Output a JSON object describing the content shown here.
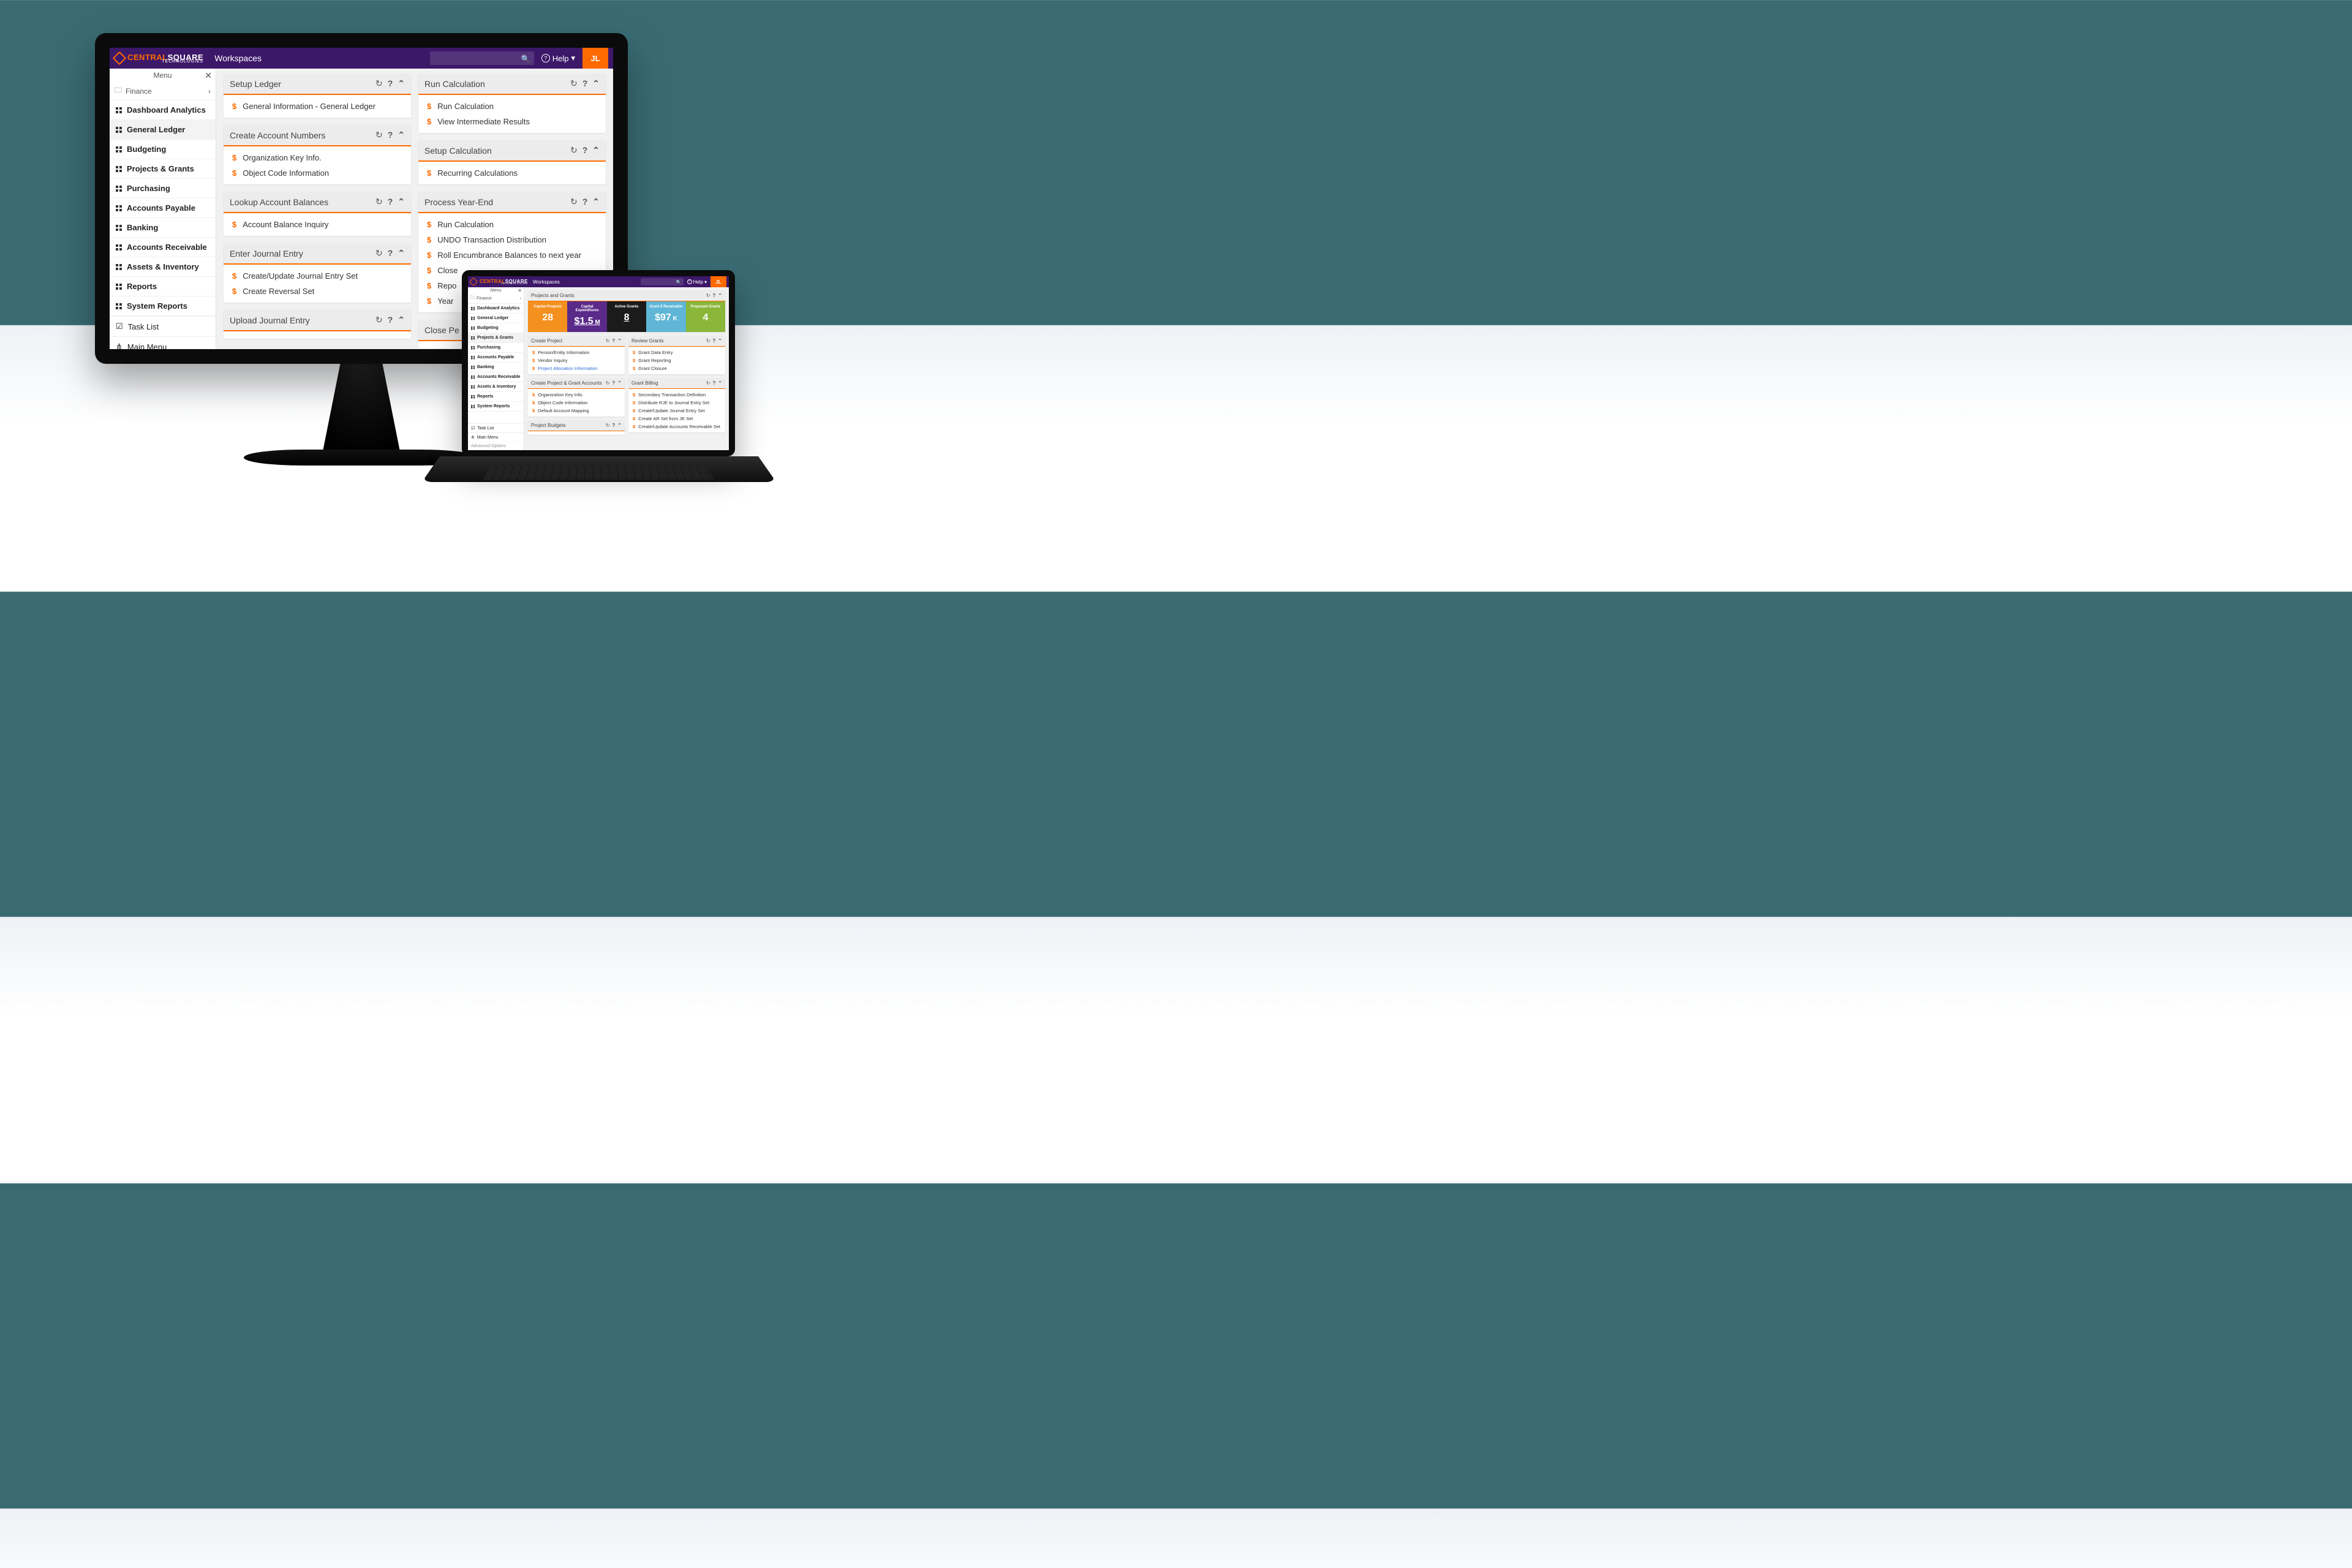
{
  "brand": {
    "name_html_prefix": "CENTRAL",
    "name_html_suffix": "SQUARE",
    "sub": "TECHNOLOGIES"
  },
  "header": {
    "title": "Workspaces",
    "help": "Help",
    "avatar": "JL",
    "menu_label": "Menu",
    "folder": "Finance"
  },
  "sidebar": {
    "items": [
      "Dashboard Analytics",
      "General Ledger",
      "Budgeting",
      "Projects & Grants",
      "Purchasing",
      "Accounts Payable",
      "Banking",
      "Accounts Receivable",
      "Assets & Inventory",
      "Reports",
      "System Reports"
    ],
    "active_desktop": "General Ledger",
    "active_laptop": "Projects & Grants",
    "tasklist": "Task List",
    "mainmenu": "Main Menu",
    "advanced": "Advanced Options"
  },
  "desktop_cards_left": [
    {
      "title": "Setup Ledger",
      "items": [
        "General Information - General Ledger"
      ]
    },
    {
      "title": "Create Account Numbers",
      "items": [
        "Organization Key Info.",
        "Object Code Information"
      ]
    },
    {
      "title": "Lookup Account Balances",
      "items": [
        "Account Balance Inquiry"
      ]
    },
    {
      "title": "Enter Journal Entry",
      "items": [
        "Create/Update Journal Entry Set",
        "Create Reversal Set"
      ]
    },
    {
      "title": "Upload Journal Entry",
      "items": []
    }
  ],
  "desktop_cards_right": [
    {
      "title": "Run Calculation",
      "items": [
        "Run Calculation",
        "View Intermediate Results"
      ]
    },
    {
      "title": "Setup Calculation",
      "items": [
        "Recurring Calculations"
      ]
    },
    {
      "title": "Process Year-End",
      "items": [
        "Run Calculation",
        "UNDO Transaction Distribution",
        "Roll Encumbrance Balances to next year",
        "Close",
        "Repo",
        "Year"
      ]
    },
    {
      "title": "Close Pe",
      "items": []
    }
  ],
  "laptop_dash": {
    "title": "Projects and Grants",
    "kpis": [
      {
        "label": "Capital Projects",
        "value": "28",
        "color": "#f4901e"
      },
      {
        "label": "Capital Expenditures",
        "value": "$1.5",
        "unit": "M",
        "underline": true,
        "color": "#5a2a89"
      },
      {
        "label": "Active Grants",
        "value": "8",
        "underline": true,
        "color": "#1b1b1b"
      },
      {
        "label": "Grant $ Receivable",
        "value": "$97",
        "unit": "K",
        "color": "#5fb6d6"
      },
      {
        "label": "Proposed Grants",
        "value": "4",
        "color": "#8ab63a"
      }
    ]
  },
  "laptop_cards_left": [
    {
      "title": "Create Project",
      "items": [
        {
          "t": "Person/Entity Information"
        },
        {
          "t": "Vendor Inquiry"
        },
        {
          "t": "Project Allocation Information",
          "link": true
        }
      ]
    },
    {
      "title": "Create Project & Grant Accounts",
      "items": [
        {
          "t": "Organization Key Info."
        },
        {
          "t": "Object Code Information"
        },
        {
          "t": "Default Account Mapping"
        }
      ]
    },
    {
      "title": "Project Budgets",
      "items": []
    }
  ],
  "laptop_cards_right": [
    {
      "title": "Review Grants",
      "items": [
        {
          "t": "Grant Data Entry"
        },
        {
          "t": "Grant Reporting"
        },
        {
          "t": "Grant Closure"
        }
      ]
    },
    {
      "title": "Grant Billing",
      "items": [
        {
          "t": "Secondary Transaction Definition"
        },
        {
          "t": "Distribute RJE to Journal Entry Set"
        },
        {
          "t": "Create/Update Journal Entry Set"
        },
        {
          "t": "Create AR Set from JE Set"
        },
        {
          "t": "Create/Update Accounts Receivable Set"
        }
      ]
    }
  ]
}
